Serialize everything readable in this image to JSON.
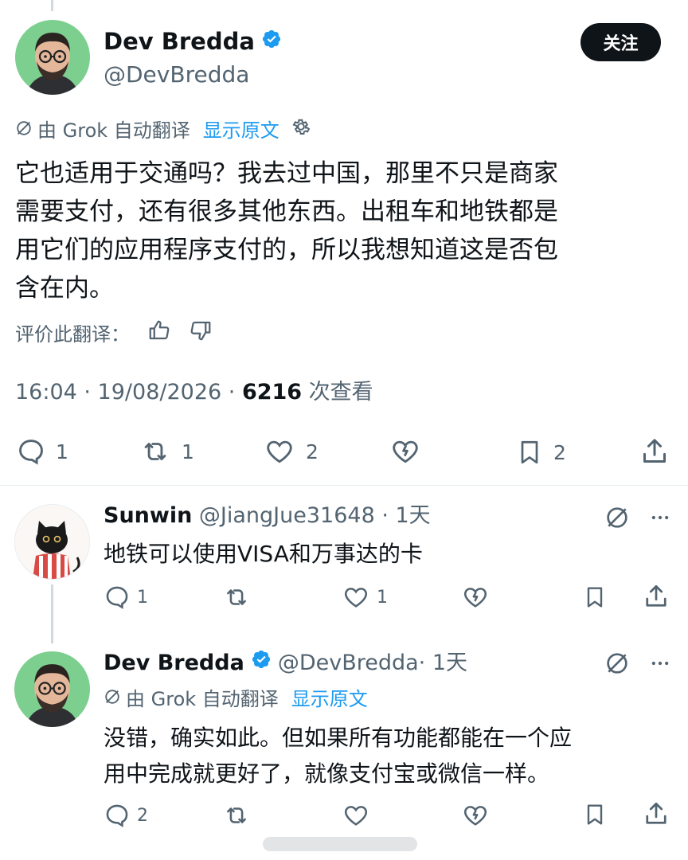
{
  "main_tweet": {
    "display_name": "Dev Bredda",
    "handle": "@DevBredda",
    "follow_label": "关注",
    "translated_by": "由 Grok 自动翻译",
    "show_original": "显示原文",
    "text_lines": [
      "它也适用于交通吗？我去过中国，那里不只是商家",
      "需要支付，还有很多其他东西。出租车和地铁都是",
      "用它们的应用程序支付的，所以我想知道这是否包",
      "含在内。"
    ],
    "rate_label": "评价此翻译：",
    "time": "16:04 · 19/08/2026 · ",
    "views": "6216",
    "views_label": " 次查看",
    "reply_count": "1",
    "retweet_count": "1",
    "like_count": "2",
    "bookmark_count": "2"
  },
  "reply1": {
    "display_name": "Sunwin",
    "handle": "@JiangJue31648",
    "age": " · 1天",
    "text": "地铁可以使用VISA和万事达的卡",
    "reply_count": "1",
    "retweet_count": "",
    "like_count": "1"
  },
  "reply2": {
    "display_name": "Dev Bredda",
    "handle": "@DevBredda",
    "age": " · 1天",
    "translated_by": "由 Grok 自动翻译",
    "show_original": "显示原文",
    "text_lines": [
      "没错，确实如此。但如果所有功能都能在一个应",
      "用中完成就更好了，就像支付宝或微信一样。"
    ],
    "reply_count": "2",
    "retweet_count": "",
    "like_count": ""
  },
  "colors": {
    "accent": "#1d9bf0",
    "text": "#0f1419",
    "muted": "#536471",
    "avatar_bg": "#6fcf8a"
  }
}
